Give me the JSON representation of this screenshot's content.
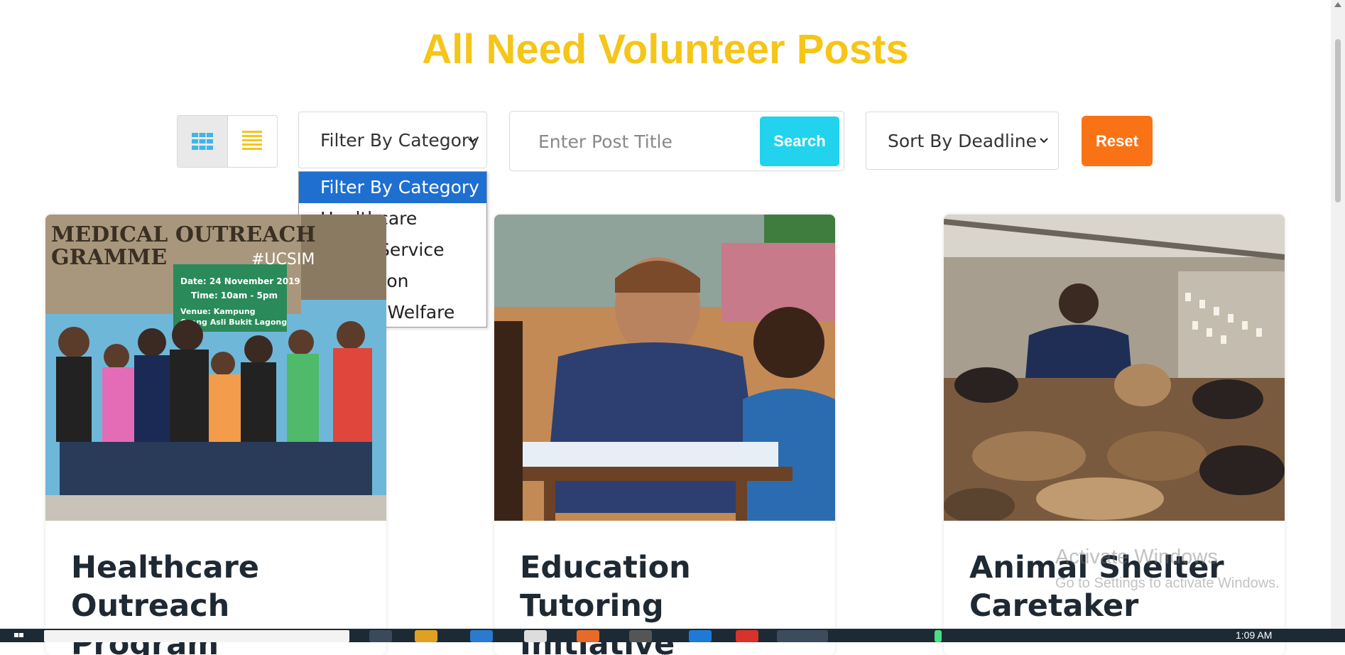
{
  "page": {
    "title": "All Need Volunteer Posts"
  },
  "controls": {
    "grid_view_icon": "grid-icon",
    "list_view_icon": "list-icon",
    "filter": {
      "selected": "Filter By Category",
      "options": [
        "Filter By Category",
        "Healthcare",
        "Social Service",
        "Education",
        "Animal Welfare"
      ]
    },
    "search": {
      "placeholder": "Enter Post Title",
      "value": "",
      "button_label": "Search"
    },
    "sort": {
      "selected": "Sort By Deadline"
    },
    "reset_label": "Reset"
  },
  "cards": [
    {
      "title_line1": "Healthcare",
      "title_line2": "Outreach Program"
    },
    {
      "title_line1": "Education Tutoring",
      "title_line2": "Initiative"
    },
    {
      "title_line1": "Animal Shelter",
      "title_line2": "Caretaker"
    }
  ],
  "card_banner": {
    "line1": "MEDICAL OUTREACH",
    "line2": "GRAMME",
    "hashtag": "#UCSIM",
    "date": "Date: 24 November 2019",
    "time": "Time: 10am - 5pm",
    "venue1": "Venue: Kampung",
    "venue2": "Orang Asli Bukit Lagong"
  },
  "watermark": {
    "line1": "Activate Windows",
    "line2": "Go to Settings to activate Windows."
  },
  "taskbar": {
    "clock": "1:09 AM"
  },
  "colors": {
    "title": "#f5c518",
    "search_button": "#22d3ee",
    "reset_button": "#f97316",
    "dropdown_highlight": "#1f6fd1"
  }
}
